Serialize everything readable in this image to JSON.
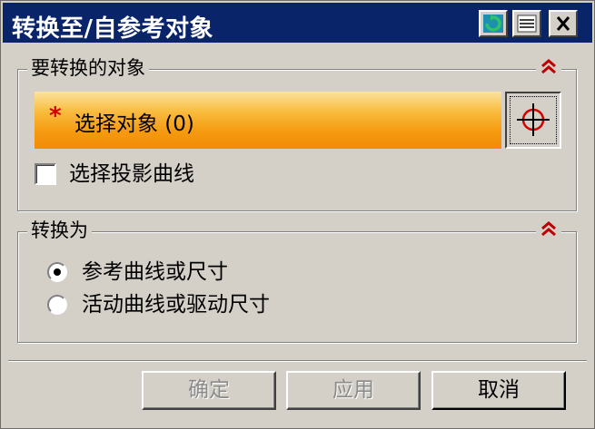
{
  "window": {
    "title": "转换至/自参考对象"
  },
  "titlebar_buttons": {
    "reset_icon": "reset-icon",
    "menu_icon": "menu-icon",
    "close_icon": "close-icon"
  },
  "section_objects": {
    "title": "要转换的对象",
    "collapse_glyph": "≈",
    "select_object": {
      "required_mark": "*",
      "label": "选择对象 (0)",
      "target_icon": "crosshair-icon",
      "colors": {
        "bar_top": "#fbe3a0",
        "bar_bottom": "#f38b08",
        "required": "#d40000"
      }
    },
    "select_projection": {
      "label": "选择投影曲线",
      "checked": false
    }
  },
  "section_convert": {
    "title": "转换为",
    "collapse_glyph": "≈",
    "options": [
      {
        "label": "参考曲线或尺寸",
        "selected": true
      },
      {
        "label": "活动曲线或驱动尺寸",
        "selected": false
      }
    ]
  },
  "buttons": {
    "ok": "确定",
    "apply": "应用",
    "cancel": "取消"
  },
  "colors": {
    "titlebar": "#0a246a",
    "face": "#d4d0c8",
    "collapse_arrows": "#c00000"
  }
}
